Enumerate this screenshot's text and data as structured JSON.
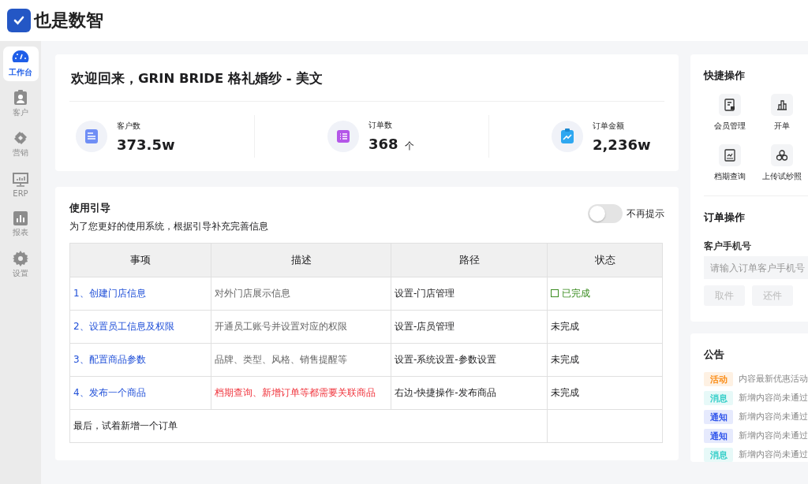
{
  "brand": {
    "name": "也是数智"
  },
  "sidebar": {
    "items": [
      {
        "label": "工作台",
        "kind": "dashboard",
        "selected": true
      },
      {
        "label": "客户",
        "kind": "badge",
        "selected": false
      },
      {
        "label": "营销",
        "kind": "cycle",
        "selected": false
      },
      {
        "label": "ERP",
        "kind": "monitor",
        "selected": false
      },
      {
        "label": "报表",
        "kind": "chart",
        "selected": false
      },
      {
        "label": "设置",
        "kind": "gear",
        "selected": false
      }
    ]
  },
  "welcome": {
    "title": "欢迎回来，GRIN BRIDE 格礼婚纱 - 美文",
    "stats": [
      {
        "label": "客户数",
        "value": "373.5w",
        "kind": "doc"
      },
      {
        "label": "订单数",
        "value": "368",
        "unit": "个",
        "kind": "list"
      },
      {
        "label": "订单金额",
        "value": "2,236w",
        "kind": "clipboard"
      }
    ]
  },
  "guide": {
    "title": "使用引导",
    "subtitle": "为了您更好的使用系统，根据引导补充完善信息",
    "toggle": {
      "label": "不再提示",
      "on": false
    },
    "columns": [
      "事项",
      "描述",
      "路径",
      "状态"
    ],
    "rows": [
      {
        "item": "1、创建门店信息",
        "description": "对外门店展示信息",
        "warning": false,
        "path": "设置-门店管理",
        "status": "已完成",
        "done": true
      },
      {
        "item": "2、设置员工信息及权限",
        "description": "开通员工账号并设置对应的权限",
        "warning": false,
        "path": "设置-店员管理",
        "status": "未完成",
        "done": false
      },
      {
        "item": "3、配置商品参数",
        "description": "品牌、类型、风格、销售提醒等",
        "warning": false,
        "path": "设置-系统设置-参数设置",
        "status": "未完成",
        "done": false
      },
      {
        "item": "4、发布一个商品",
        "description": "档期查询、新增订单等都需要关联商品",
        "warning": true,
        "path": "右边-快捷操作-发布商品",
        "status": "未完成",
        "done": false
      }
    ],
    "footer": "最后，试着新增一个订单"
  },
  "quick_actions": {
    "title": "快捷操作",
    "items": [
      {
        "label": "会员管理",
        "kind": "member"
      },
      {
        "label": "开单",
        "kind": "bars"
      },
      {
        "label": "档期查询",
        "kind": "calendar"
      },
      {
        "label": "上传试纱照",
        "kind": "circles"
      }
    ]
  },
  "order_ops": {
    "title": "订单操作",
    "field_label": "客户手机号",
    "placeholder": "请输入订单客户手机号",
    "buttons": [
      {
        "label": "取件",
        "disabled": true
      },
      {
        "label": "还件",
        "disabled": true
      }
    ]
  },
  "notices": {
    "title": "公告",
    "items": [
      {
        "tag": "活动",
        "color": "#fa8c16",
        "text": "内容最新优惠活动"
      },
      {
        "tag": "消息",
        "color": "#36cfc9",
        "text": "新增内容尚未通过"
      },
      {
        "tag": "通知",
        "color": "#2f54eb",
        "text": "新增内容尚未通过"
      },
      {
        "tag": "通知",
        "color": "#2f54eb",
        "text": "新增内容尚未通过"
      },
      {
        "tag": "消息",
        "color": "#36cfc9",
        "text": "新增内容尚未通过"
      }
    ]
  }
}
